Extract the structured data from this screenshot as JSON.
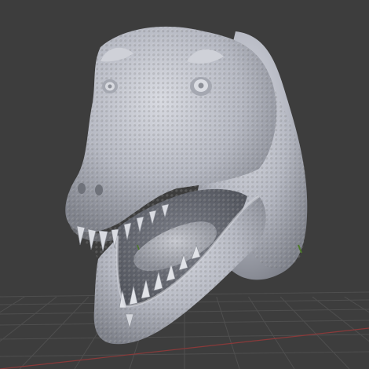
{
  "viewport": {
    "background_color": "#3d3d3d",
    "grid_color": "#4f4f4f",
    "x_axis_color": "#8a3a3a",
    "y_axis_color": "#4d7a2a",
    "model_color": "#b9bcc6",
    "model_shadow_color": "#8a8d96",
    "model_highlight_color": "#d6d8df",
    "mouth_interior_color": "#9ea1ab",
    "object_origin_icon": "empty-axes-icon"
  }
}
